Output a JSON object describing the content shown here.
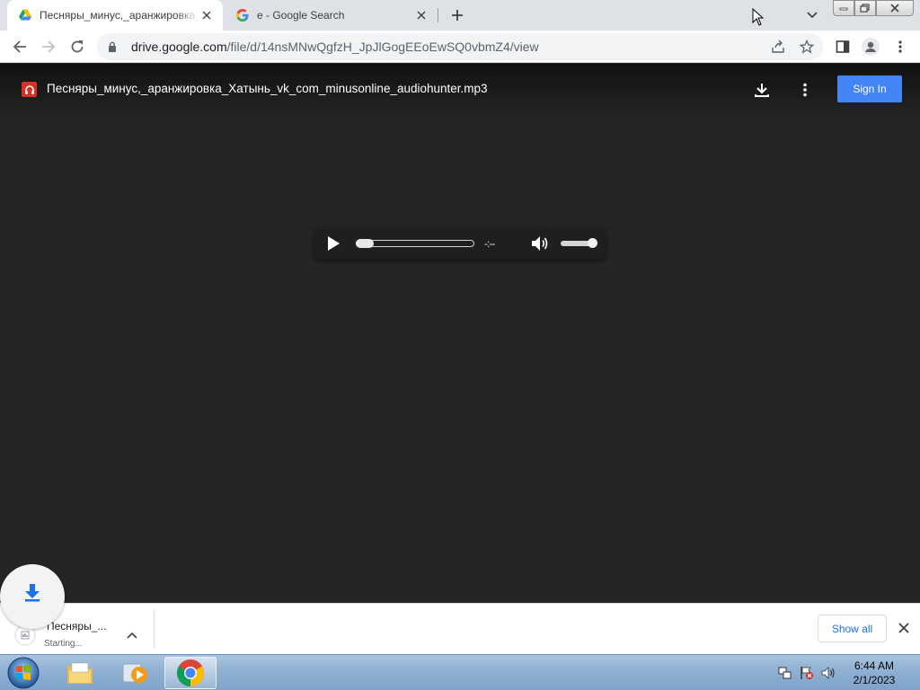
{
  "browser": {
    "tabs": [
      {
        "title": "Песняры_минус,_аранжировка_",
        "favicon": "google-drive-icon",
        "active": true
      },
      {
        "title": "e - Google Search",
        "favicon": "google-g-icon",
        "active": false
      }
    ],
    "new_tab_icon": "plus-icon",
    "address": {
      "host": "drive.google.com",
      "path": "/file/d/14nsMNwQgfzH_JpJlGogEEoEwSQ0vbmZ4/view"
    }
  },
  "viewer": {
    "filename": "Песняры_минус,_аранжировка_Хатынь_vk_com_minusonline_audiohunter.mp3",
    "sign_in_label": "Sign In",
    "player": {
      "time": "-:--",
      "progress_fraction": 0,
      "volume_fraction": 1
    }
  },
  "download_shelf": {
    "item_name": "Песняры_...",
    "item_status": "Starting...",
    "show_all_label": "Show all"
  },
  "taskbar": {
    "time": "6:44 AM",
    "date": "2/1/2023"
  },
  "colors": {
    "accent": "#4285f4",
    "viewer_bg": "#252525",
    "file_icon": "#d93025"
  }
}
